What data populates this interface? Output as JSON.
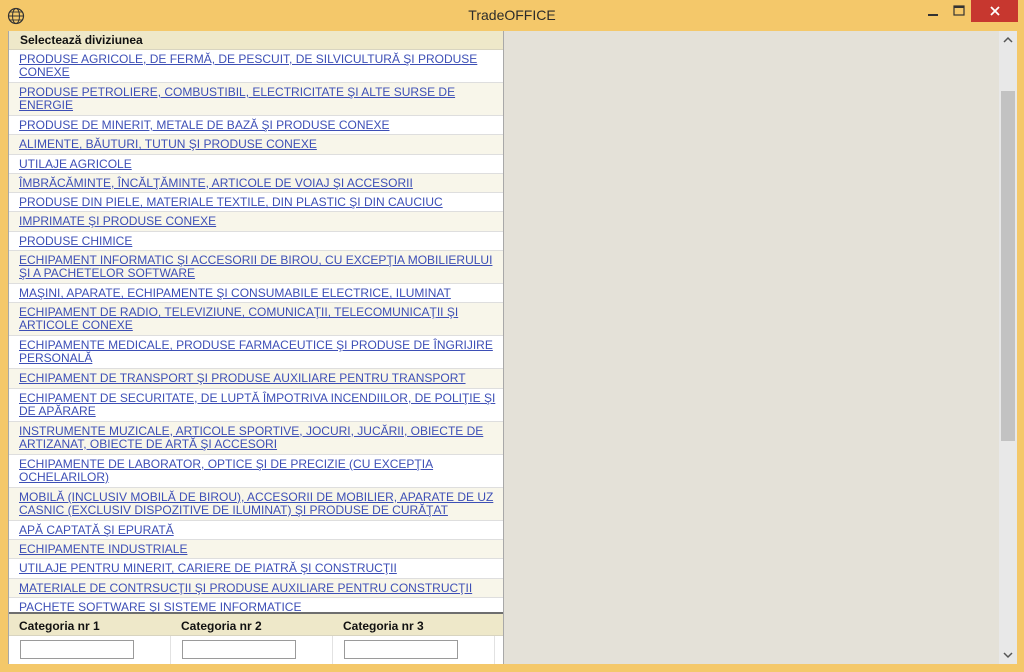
{
  "window": {
    "title": "TradeOFFICE",
    "colors": {
      "frame": "#f4c86a",
      "close": "#c7372f",
      "link": "#3d4fb6",
      "header": "#eee8c9"
    }
  },
  "divisions": {
    "header": "Selectează diviziunea",
    "items": [
      "PRODUSE AGRICOLE, DE FERMĂ, DE PESCUIT, DE SILVICULTURĂ ŞI PRODUSE CONEXE",
      "PRODUSE PETROLIERE, COMBUSTIBIL, ELECTRICITATE ŞI ALTE SURSE DE ENERGIE",
      "PRODUSE DE MINERIT, METALE DE BAZĂ ŞI PRODUSE CONEXE",
      "ALIMENTE, BĂUTURI, TUTUN ŞI PRODUSE CONEXE",
      "UTILAJE AGRICOLE",
      "ÎMBRĂCĂMINTE, ÎNCĂLŢĂMINTE, ARTICOLE DE VOIAJ ŞI ACCESORII",
      "PRODUSE DIN PIELE, MATERIALE TEXTILE, DIN PLASTIC ŞI DIN CAUCIUC",
      "IMPRIMATE ŞI PRODUSE CONEXE",
      "PRODUSE CHIMICE",
      "ECHIPAMENT INFORMATIC ŞI ACCESORII DE BIROU, CU EXCEPŢIA MOBILIERULUI ŞI A PACHETELOR SOFTWARE",
      "MAŞINI, APARATE, ECHIPAMENTE ŞI CONSUMABILE ELECTRICE, ILUMINAT",
      "ECHIPAMENT DE RADIO, TELEVIZIUNE, COMUNICAŢII, TELECOMUNICAŢII ŞI ARTICOLE CONEXE",
      "ECHIPAMENTE MEDICALE, PRODUSE FARMACEUTICE ŞI PRODUSE DE ÎNGRIJIRE PERSONALĂ",
      "ECHIPAMENT DE TRANSPORT ŞI PRODUSE AUXILIARE PENTRU TRANSPORT",
      "ECHIPAMENT DE SECURITATE, DE LUPTĂ ÎMPOTRIVA INCENDIILOR, DE POLIŢIE ŞI DE APĂRARE",
      "INSTRUMENTE MUZICALE, ARTICOLE SPORTIVE, JOCURI, JUCĂRII, OBIECTE DE ARTIZANAT, OBIECTE DE ARTĂ ŞI ACCESORI",
      "ECHIPAMENTE DE LABORATOR, OPTICE ŞI DE PRECIZIE (CU EXCEPŢIA OCHELARILOR)",
      "MOBILĂ (INCLUSIV MOBILĂ DE BIROU), ACCESORII DE MOBILIER, APARATE DE UZ CASNIC (EXCLUSIV DISPOZITIVE DE ILUMINAT) ŞI PRODUSE DE CURĂŢAT",
      "APĂ CAPTATĂ ŞI EPURATĂ",
      "ECHIPAMENTE INDUSTRIALE",
      "UTILAJE PENTRU MINERIT, CARIERE DE PIATRĂ ŞI CONSTRUCŢII",
      "MATERIALE DE CONTRSUCŢII ŞI PRODUSE AUXILIARE PENTRU CONSTRUCŢII",
      "PACHETE SOFTWARE ŞI SISTEME INFORMATICE"
    ]
  },
  "categories": {
    "headers": [
      "Categoria nr 1",
      "Categoria nr 2",
      "Categoria nr 3"
    ],
    "values": [
      "",
      "",
      ""
    ]
  },
  "icons": {
    "app": "globe-icon",
    "minimize": "minimize-icon",
    "maximize": "maximize-icon",
    "close": "close-icon",
    "scroll_up": "chevron-up-icon",
    "scroll_down": "chevron-down-icon"
  }
}
